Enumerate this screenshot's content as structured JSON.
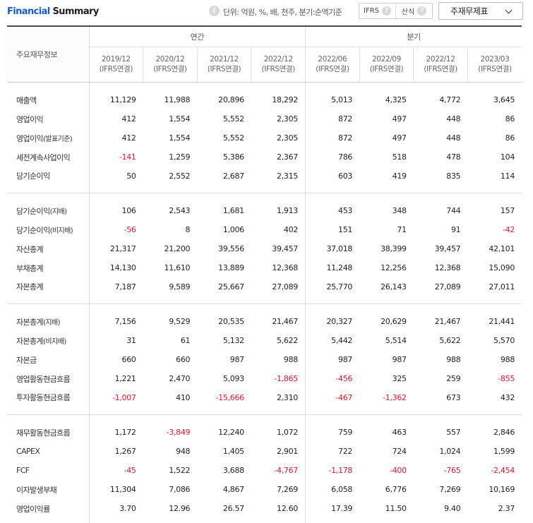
{
  "header": {
    "title_part1": "Financial",
    "title_part2": " Summary",
    "unit_text": "단위: 억원, %, 배, 천주, 분기:순액기준",
    "toggle_ifrs": "IFRS",
    "toggle_calc": "산식",
    "help_glyph": "?",
    "statement_select": "주재무제표"
  },
  "table": {
    "label_header": "주요재무정보",
    "annual_header": "연간",
    "quarterly_header": "분기",
    "periods": [
      {
        "date": "2019/12",
        "basis": "(IFRS연결)"
      },
      {
        "date": "2020/12",
        "basis": "(IFRS연결)"
      },
      {
        "date": "2021/12",
        "basis": "(IFRS연결)"
      },
      {
        "date": "2022/12",
        "basis": "(IFRS연결)"
      },
      {
        "date": "2022/06",
        "basis": "(IFRS연결)"
      },
      {
        "date": "2022/09",
        "basis": "(IFRS연결)"
      },
      {
        "date": "2022/12",
        "basis": "(IFRS연결)"
      },
      {
        "date": "2023/03",
        "basis": "(IFRS연결)"
      }
    ],
    "rows": [
      {
        "label": "매출액",
        "suffix": "",
        "values": [
          "11,129",
          "11,988",
          "20,896",
          "18,292",
          "5,013",
          "4,325",
          "4,772",
          "3,645"
        ]
      },
      {
        "label": "영업이익",
        "suffix": "",
        "values": [
          "412",
          "1,554",
          "5,552",
          "2,305",
          "872",
          "497",
          "448",
          "86"
        ]
      },
      {
        "label": "영업이익",
        "suffix": "(발표기준)",
        "values": [
          "412",
          "1,554",
          "5,552",
          "2,305",
          "872",
          "497",
          "448",
          "86"
        ]
      },
      {
        "label": "세전계속사업이익",
        "suffix": "",
        "values": [
          "-141",
          "1,259",
          "5,386",
          "2,367",
          "786",
          "518",
          "478",
          "104"
        ]
      },
      {
        "label": "당기순이익",
        "suffix": "",
        "values": [
          "50",
          "2,552",
          "2,687",
          "2,315",
          "603",
          "419",
          "835",
          "114"
        ]
      },
      {
        "label": "당기순이익",
        "suffix": "(지배)",
        "values": [
          "106",
          "2,543",
          "1,681",
          "1,913",
          "453",
          "348",
          "744",
          "157"
        ]
      },
      {
        "label": "당기순이익",
        "suffix": "(비지배)",
        "values": [
          "-56",
          "8",
          "1,006",
          "402",
          "151",
          "71",
          "91",
          "-42"
        ]
      },
      {
        "label": "자산총계",
        "suffix": "",
        "values": [
          "21,317",
          "21,200",
          "39,556",
          "39,457",
          "37,018",
          "38,399",
          "39,457",
          "42,101"
        ]
      },
      {
        "label": "부채총계",
        "suffix": "",
        "values": [
          "14,130",
          "11,610",
          "13,889",
          "12,368",
          "11,248",
          "12,256",
          "12,368",
          "15,090"
        ]
      },
      {
        "label": "자본총계",
        "suffix": "",
        "values": [
          "7,187",
          "9,589",
          "25,667",
          "27,089",
          "25,770",
          "26,143",
          "27,089",
          "27,011"
        ]
      },
      {
        "label": "자본총계",
        "suffix": "(지배)",
        "values": [
          "7,156",
          "9,529",
          "20,535",
          "21,467",
          "20,327",
          "20,629",
          "21,467",
          "21,441"
        ]
      },
      {
        "label": "자본총계",
        "suffix": "(비지배)",
        "values": [
          "31",
          "61",
          "5,132",
          "5,622",
          "5,442",
          "5,514",
          "5,622",
          "5,570"
        ]
      },
      {
        "label": "자본금",
        "suffix": "",
        "values": [
          "660",
          "660",
          "987",
          "988",
          "987",
          "987",
          "988",
          "988"
        ]
      },
      {
        "label": "영업활동현금흐름",
        "suffix": "",
        "values": [
          "1,221",
          "2,470",
          "5,093",
          "-1,865",
          "-456",
          "325",
          "259",
          "-855"
        ]
      },
      {
        "label": "투자활동현금흐름",
        "suffix": "",
        "values": [
          "-1,007",
          "410",
          "-15,666",
          "2,310",
          "-467",
          "-1,362",
          "673",
          "432"
        ]
      },
      {
        "label": "재무활동현금흐름",
        "suffix": "",
        "values": [
          "1,172",
          "-3,849",
          "12,240",
          "1,072",
          "759",
          "463",
          "557",
          "2,846"
        ]
      },
      {
        "label": "CAPEX",
        "suffix": "",
        "values": [
          "1,267",
          "948",
          "1,405",
          "2,901",
          "722",
          "724",
          "1,024",
          "1,599"
        ]
      },
      {
        "label": "FCF",
        "suffix": "",
        "values": [
          "-45",
          "1,522",
          "3,688",
          "-4,767",
          "-1,178",
          "-400",
          "-765",
          "-2,454"
        ]
      },
      {
        "label": "이자발생부채",
        "suffix": "",
        "values": [
          "11,304",
          "7,086",
          "4,867",
          "7,269",
          "6,058",
          "6,776",
          "7,269",
          "10,169"
        ]
      },
      {
        "label": "영업이익률",
        "suffix": "",
        "values": [
          "3.70",
          "12.96",
          "26.57",
          "12.60",
          "17.39",
          "11.50",
          "9.40",
          "2.37"
        ]
      }
    ]
  },
  "colors": {
    "title_blue": "#1a5fc8",
    "negative_red": "#e0162b",
    "header_border": "#4a4a4a"
  }
}
